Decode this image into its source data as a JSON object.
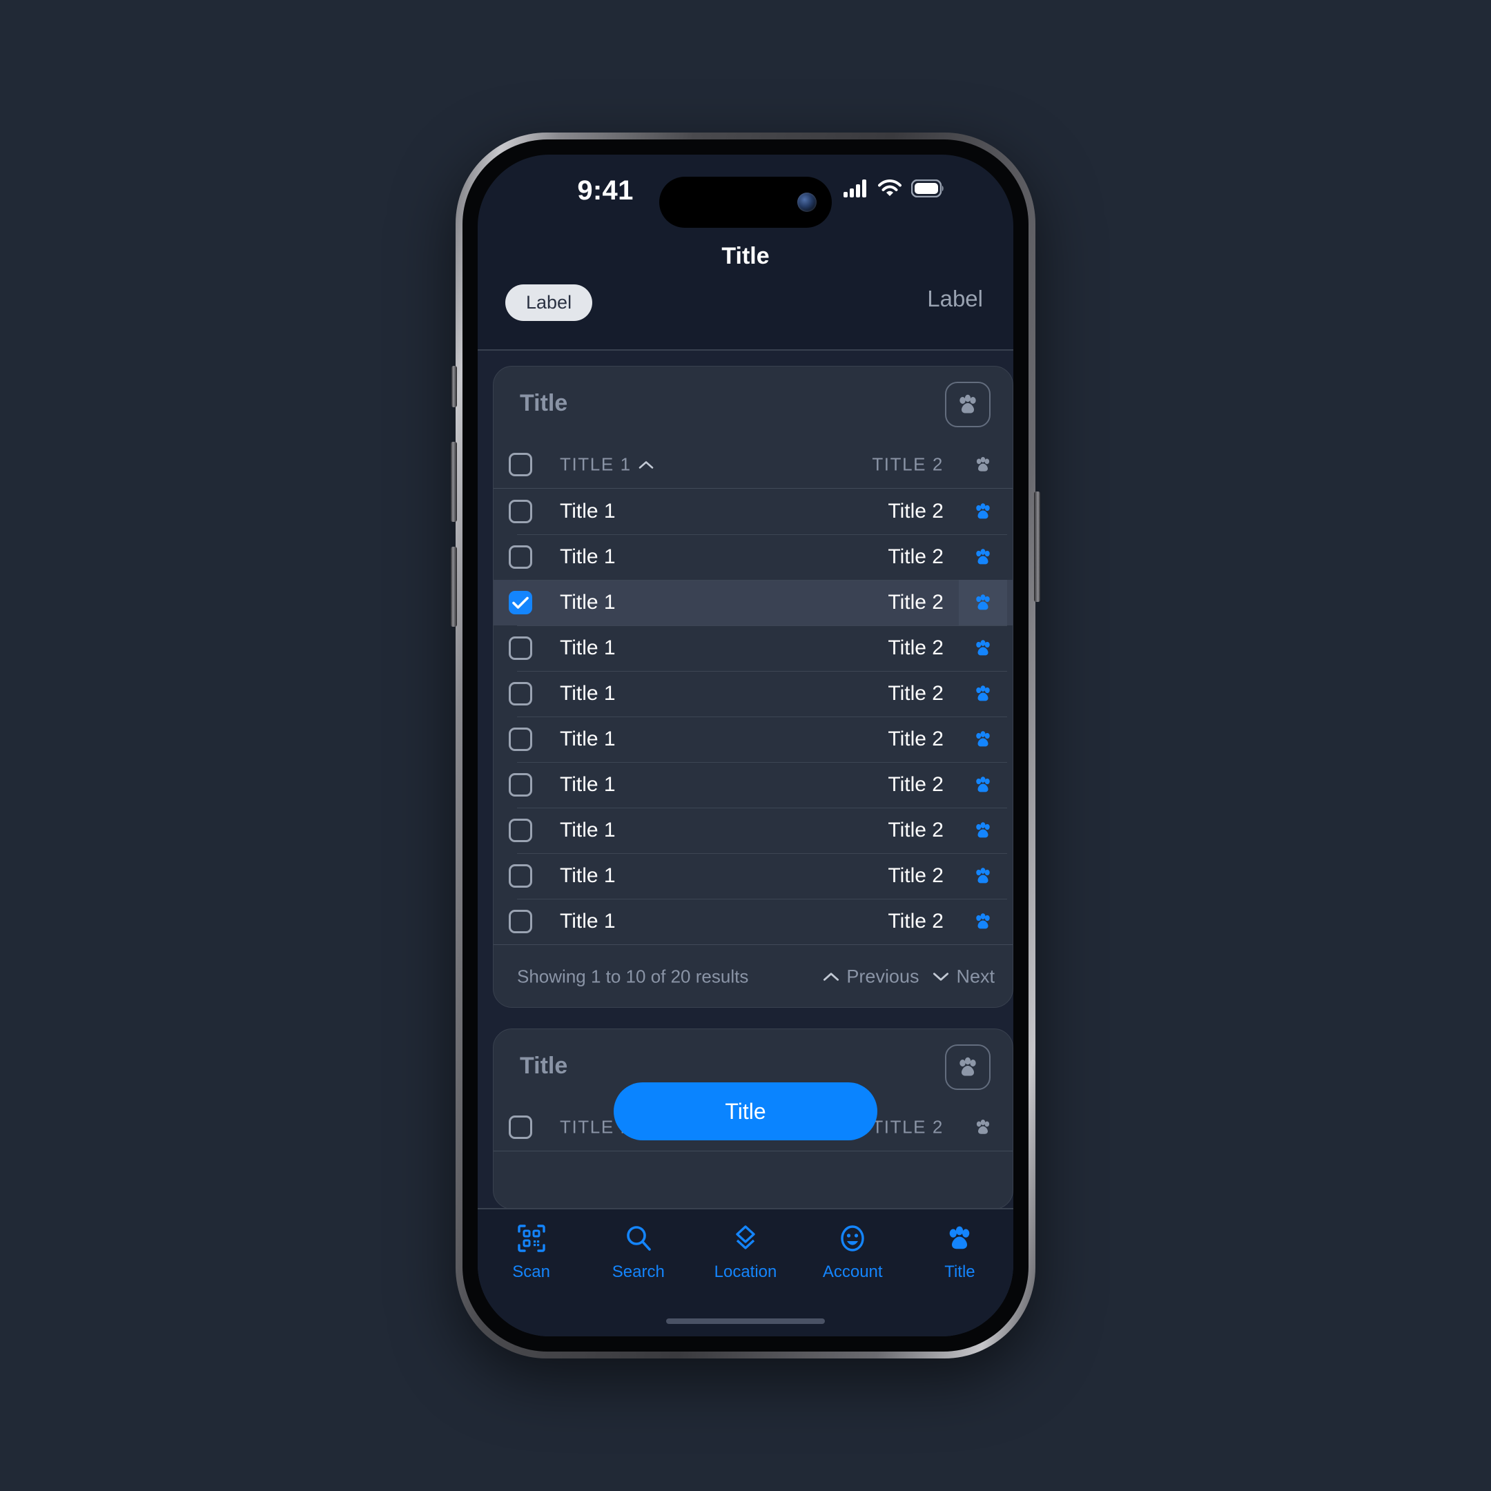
{
  "status_bar": {
    "time": "9:41",
    "cellular_icon": "signal-bars-icon",
    "wifi_icon": "wifi-icon",
    "battery_icon": "battery-icon"
  },
  "nav": {
    "title": "Title",
    "left_chip_label": "Label",
    "right_label": "Label"
  },
  "card_1": {
    "title": "Title",
    "action_icon": "paw-icon",
    "table": {
      "header": {
        "col1": "TITLE 1",
        "col2": "TITLE 2",
        "sort_icon": "chevron-up-icon",
        "select_all_checkbox": false,
        "paw_icon": "paw-icon"
      },
      "rows": [
        {
          "checked": false,
          "col1": "Title 1",
          "col2": "Title 2",
          "icon": "paw-icon"
        },
        {
          "checked": false,
          "col1": "Title 1",
          "col2": "Title 2",
          "icon": "paw-icon"
        },
        {
          "checked": true,
          "col1": "Title 1",
          "col2": "Title 2",
          "icon": "paw-icon"
        },
        {
          "checked": false,
          "col1": "Title 1",
          "col2": "Title 2",
          "icon": "paw-icon"
        },
        {
          "checked": false,
          "col1": "Title 1",
          "col2": "Title 2",
          "icon": "paw-icon"
        },
        {
          "checked": false,
          "col1": "Title 1",
          "col2": "Title 2",
          "icon": "paw-icon"
        },
        {
          "checked": false,
          "col1": "Title 1",
          "col2": "Title 2",
          "icon": "paw-icon"
        },
        {
          "checked": false,
          "col1": "Title 1",
          "col2": "Title 2",
          "icon": "paw-icon"
        },
        {
          "checked": false,
          "col1": "Title 1",
          "col2": "Title 2",
          "icon": "paw-icon"
        },
        {
          "checked": false,
          "col1": "Title 1",
          "col2": "Title 2",
          "icon": "paw-icon"
        }
      ],
      "footer": {
        "results_text": "Showing 1 to 10 of 20 results",
        "previous_label": "Previous",
        "next_label": "Next",
        "previous_icon": "chevron-up-icon",
        "next_icon": "chevron-down-icon"
      }
    }
  },
  "card_2": {
    "title": "Title",
    "action_icon": "paw-icon",
    "header": {
      "col1": "TITLE 1",
      "col2": "TITLE 2",
      "sort_icon": "chevron-up-icon",
      "paw_icon": "paw-icon"
    }
  },
  "floating_button": {
    "label": "Title"
  },
  "tab_bar": {
    "items": [
      {
        "label": "Scan",
        "icon": "qr-code-icon",
        "active": true
      },
      {
        "label": "Search",
        "icon": "search-icon",
        "active": true
      },
      {
        "label": "Location",
        "icon": "layers-icon",
        "active": true
      },
      {
        "label": "Account",
        "icon": "smiley-icon",
        "active": true
      },
      {
        "label": "Title",
        "icon": "paw-icon",
        "active": true
      }
    ]
  },
  "colors": {
    "canvas": "#212936",
    "screen_bg": "#1b2233",
    "nav_bg": "#151c2c",
    "card_bg": "#29313f",
    "card_border": "#39414f",
    "accent_blue": "#1485fd",
    "fab_blue": "#0a84ff",
    "muted_text": "#8a94a6",
    "selected_row_bg": "#3a4253",
    "chip_bg": "#e3e6eb"
  }
}
